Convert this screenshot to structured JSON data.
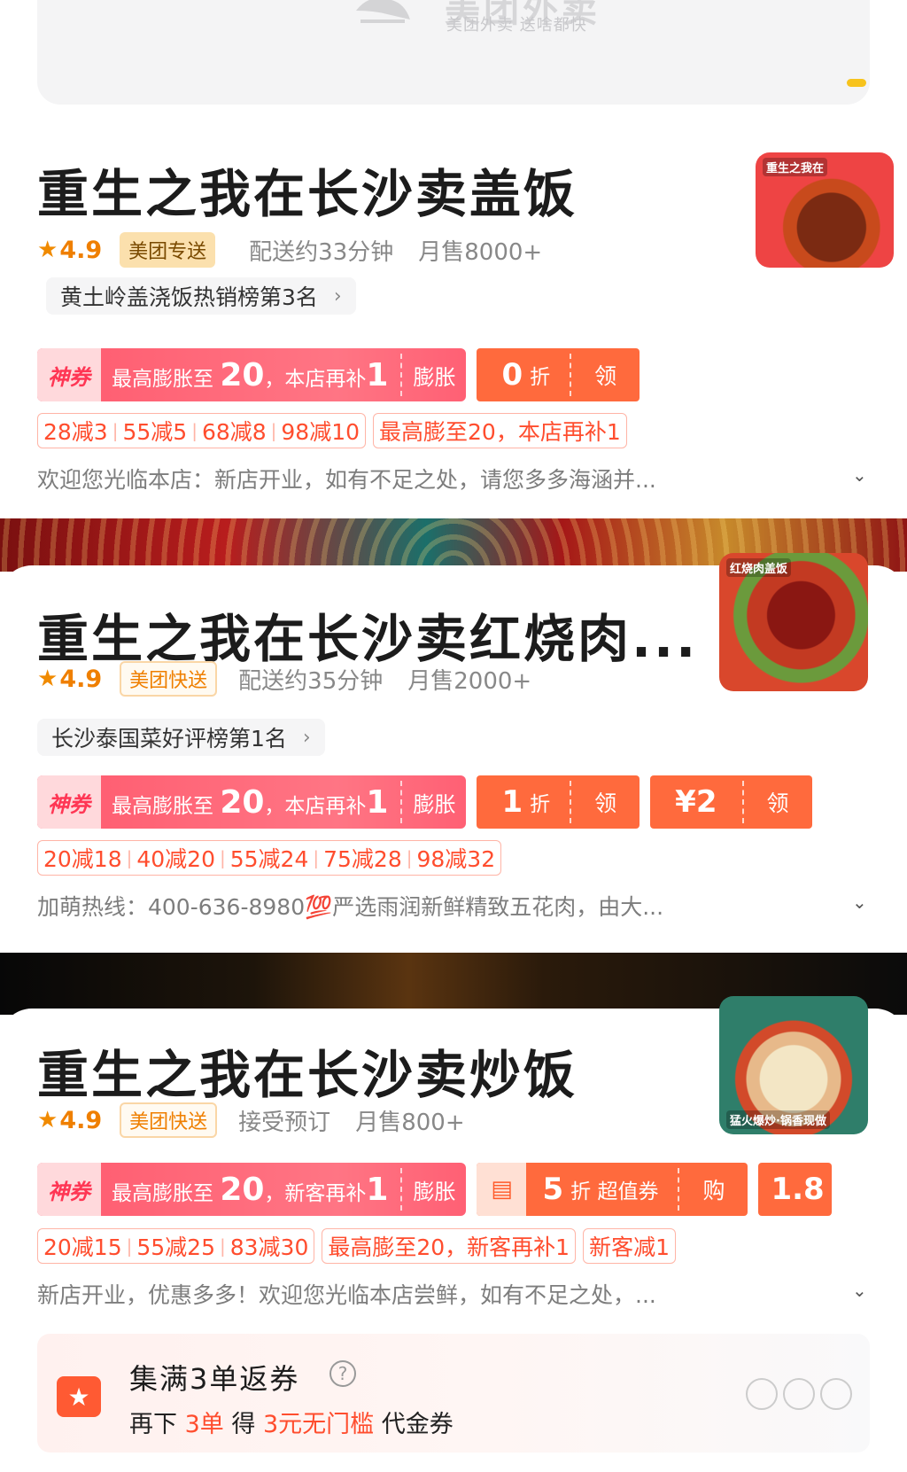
{
  "banner": {
    "title": "美团外卖",
    "subtitle": "美团外卖 送啥都快"
  },
  "stores": [
    {
      "name": "重生之我在长沙卖盖饭",
      "rating": "4.9",
      "delivery_tag": "美团专送",
      "delivery_time": "配送约33分钟",
      "monthly_sales": "月售8000+",
      "rank": "黄土岭盖浇饭热销榜第3名",
      "thumb_caption": "重生之我在",
      "shenquan": {
        "label": "神券",
        "prefix": "最高膨胀至",
        "big": "20",
        "suffix": "，本店再补",
        "extra": "1",
        "action": "膨胀"
      },
      "coupons": [
        {
          "value": "0",
          "unit": "折",
          "action": "领"
        }
      ],
      "discounts": [
        [
          "28减3",
          "55减5",
          "68减8",
          "98减10"
        ],
        [
          "最高膨至20，本店再补1"
        ]
      ],
      "notice": "欢迎您光临本店：新店开业，如有不足之处，请您多多海涵并..."
    },
    {
      "name": "重生之我在长沙卖红烧肉...",
      "rating": "4.9",
      "delivery_tag": "美团快送",
      "delivery_time": "配送约35分钟",
      "monthly_sales": "月售2000+",
      "rank": "长沙泰国菜好评榜第1名",
      "thumb_caption": "红烧肉盖饭",
      "shenquan": {
        "label": "神券",
        "prefix": "最高膨胀至",
        "big": "20",
        "suffix": "，本店再补",
        "extra": "1",
        "action": "膨胀"
      },
      "coupons": [
        {
          "value": "1",
          "unit": "折",
          "action": "领"
        },
        {
          "value": "¥2",
          "unit": "",
          "action": "领"
        }
      ],
      "discounts": [
        [
          "20减18",
          "40减20",
          "55减24",
          "75减28",
          "98减32"
        ]
      ],
      "notice": "加萌热线：400-636-8980💯严选雨润新鲜精致五花肉，由大..."
    },
    {
      "name": "重生之我在长沙卖炒饭",
      "rating": "4.9",
      "delivery_tag": "美团快送",
      "delivery_time": "接受预订",
      "monthly_sales": "月售800+",
      "thumb_caption": "猛火爆炒·锅香现做",
      "shenquan": {
        "label": "神券",
        "prefix": "最高膨胀至",
        "big": "20",
        "suffix": "，新客再补",
        "extra": "1",
        "action": "膨胀"
      },
      "coupons": [
        {
          "value": "5",
          "unit": "折 超值券",
          "action": "购"
        }
      ],
      "coupon_partial": "1.8",
      "discounts": [
        [
          "20减15",
          "55减25",
          "83减30"
        ],
        [
          "最高膨至20，新客再补1"
        ],
        [
          "新客减1"
        ]
      ],
      "notice": "新店开业，优惠多多！欢迎您光临本店尝鲜，如有不足之处，..."
    }
  ],
  "collect": {
    "title": "集满3单返券",
    "help_icon": "?",
    "sub_prefix": "再下",
    "sub_count": "3单",
    "sub_mid": "得",
    "sub_reward": "3元无门槛",
    "sub_suffix": "代金券",
    "progress_done": 0,
    "progress_total": 3
  },
  "colors": {
    "accent_orange": "#ff6a3d",
    "shenquan_pink": "#ff5a6e",
    "rating_orange": "#ef7f00",
    "discount_red": "#ff4d2e"
  }
}
